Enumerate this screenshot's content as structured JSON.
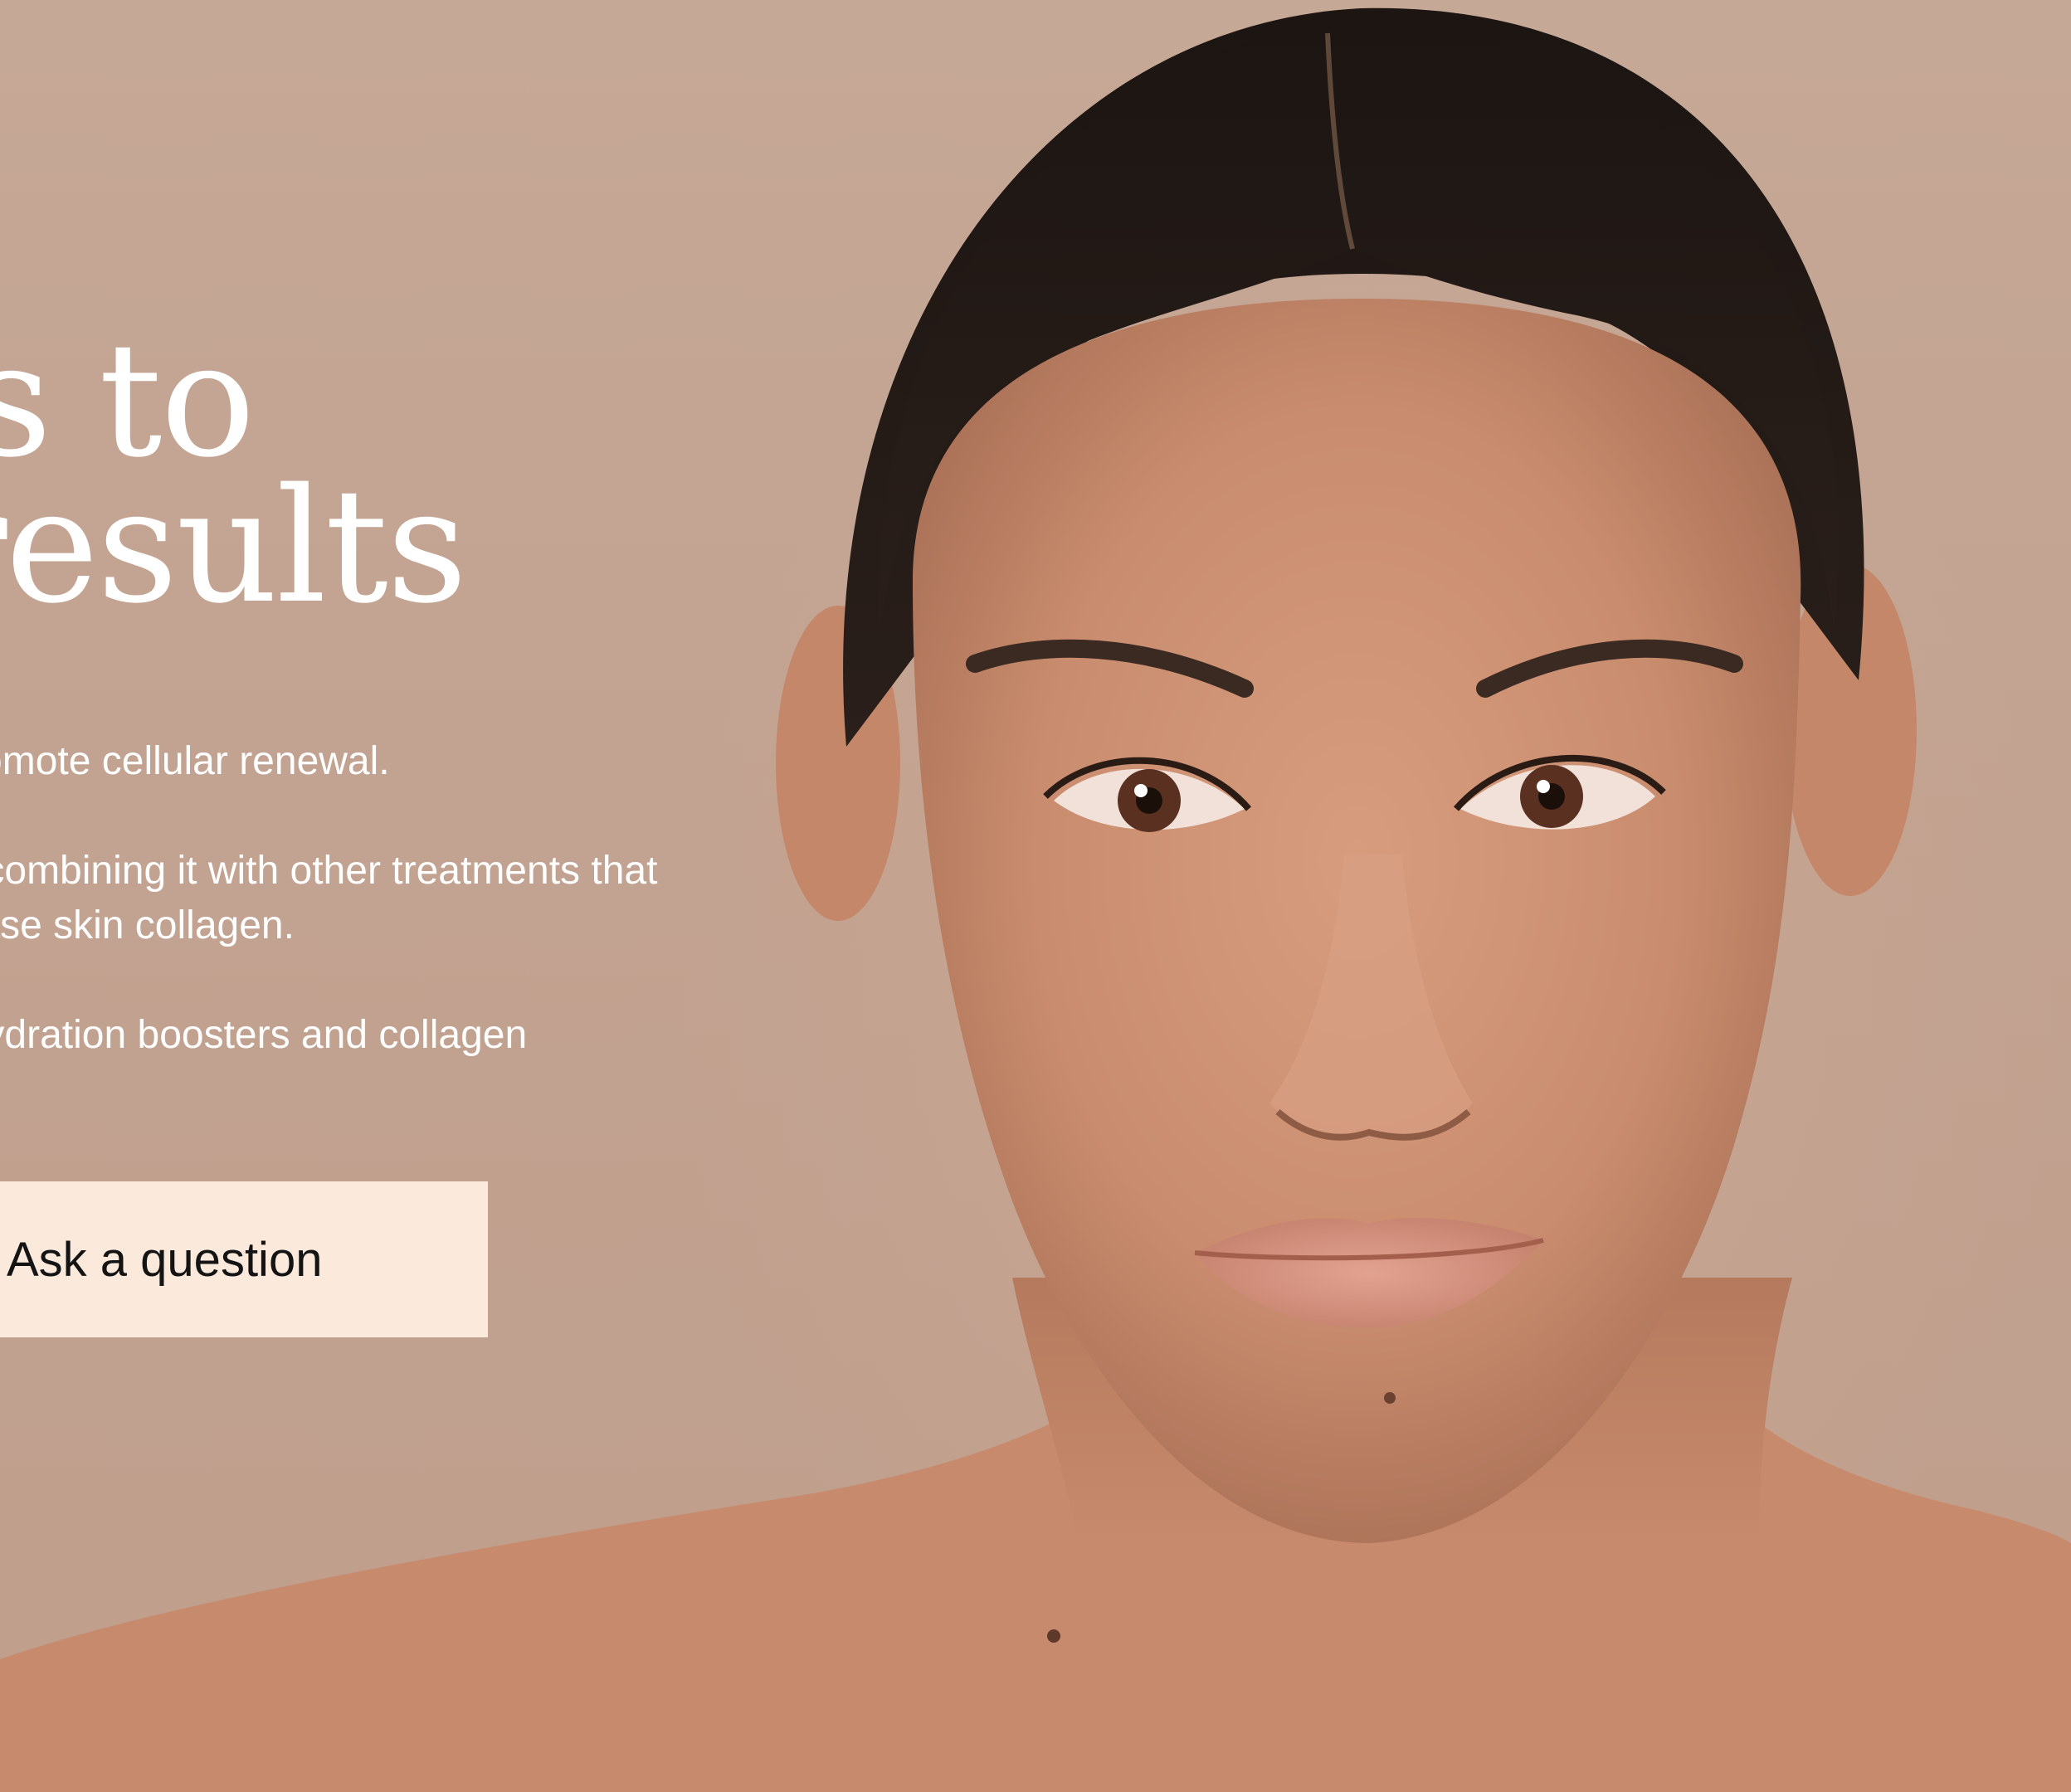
{
  "hero": {
    "headline_line1": "ents to",
    "headline_line2": "er results",
    "paragraphs": [
      {
        "lines": [
          "to promote cellular renewal."
        ]
      },
      {
        "lines": [
          "s by combining it with other treatments that",
          "ncrease skin collagen."
        ]
      },
      {
        "lines": [
          "kin hydration boosters and collagen"
        ]
      }
    ],
    "cta_label": "Ask a question"
  },
  "colors": {
    "background": "#c4a593",
    "text": "#ffffff",
    "button_bg": "#fbeadc",
    "button_text": "#141414"
  }
}
